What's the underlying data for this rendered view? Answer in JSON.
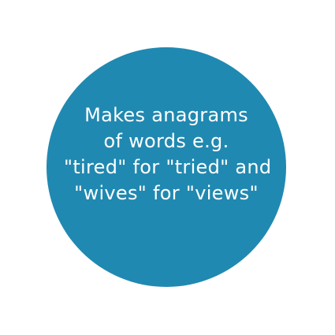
{
  "colors": {
    "background": "#ffffff",
    "circle_fill": "#2089b1",
    "text": "#ffffff"
  },
  "caption": {
    "lines": [
      "Makes anagrams",
      "of words e.g.",
      "\"tired\" for \"tried\" and",
      "\"wives\" for \"views\""
    ]
  }
}
